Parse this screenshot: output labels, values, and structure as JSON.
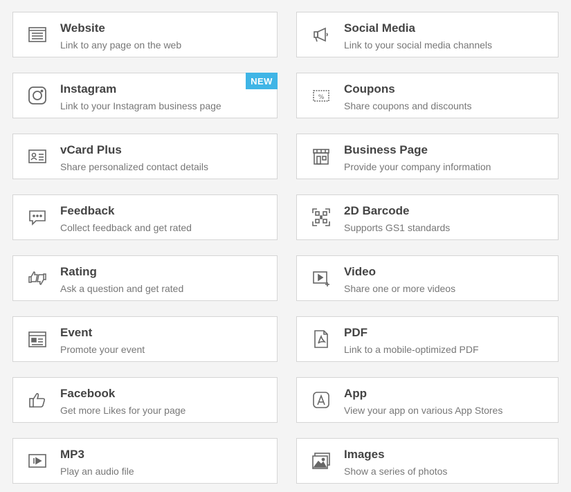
{
  "colors": {
    "background": "#f4f4f4",
    "card": "#ffffff",
    "border": "#d5d5d5",
    "icon": "#666666",
    "badge": "#3fb5e6"
  },
  "cards": [
    {
      "title": "Website",
      "subtitle": "Link to any page on the web",
      "icon": "website-icon"
    },
    {
      "title": "Social Media",
      "subtitle": "Link to your social media channels",
      "icon": "megaphone-icon"
    },
    {
      "title": "Instagram",
      "subtitle": "Link to your Instagram business page",
      "icon": "instagram-icon",
      "badge": "NEW"
    },
    {
      "title": "Coupons",
      "subtitle": "Share coupons and discounts",
      "icon": "coupon-icon"
    },
    {
      "title": "vCard Plus",
      "subtitle": "Share personalized contact details",
      "icon": "vcard-icon"
    },
    {
      "title": "Business Page",
      "subtitle": "Provide your company information",
      "icon": "storefront-icon"
    },
    {
      "title": "Feedback",
      "subtitle": "Collect feedback and get rated",
      "icon": "feedback-icon"
    },
    {
      "title": "2D Barcode",
      "subtitle": "Supports GS1 standards",
      "icon": "barcode-icon"
    },
    {
      "title": "Rating",
      "subtitle": "Ask a question and get rated",
      "icon": "rating-icon"
    },
    {
      "title": "Video",
      "subtitle": "Share one or more videos",
      "icon": "video-icon"
    },
    {
      "title": "Event",
      "subtitle": "Promote your event",
      "icon": "event-icon"
    },
    {
      "title": "PDF",
      "subtitle": "Link to a mobile-optimized PDF",
      "icon": "pdf-icon"
    },
    {
      "title": "Facebook",
      "subtitle": "Get more Likes for your page",
      "icon": "thumbs-up-icon"
    },
    {
      "title": "App",
      "subtitle": "View your app on various App Stores",
      "icon": "app-store-icon"
    },
    {
      "title": "MP3",
      "subtitle": "Play an audio file",
      "icon": "audio-icon"
    },
    {
      "title": "Images",
      "subtitle": "Show a series of photos",
      "icon": "images-icon"
    }
  ]
}
